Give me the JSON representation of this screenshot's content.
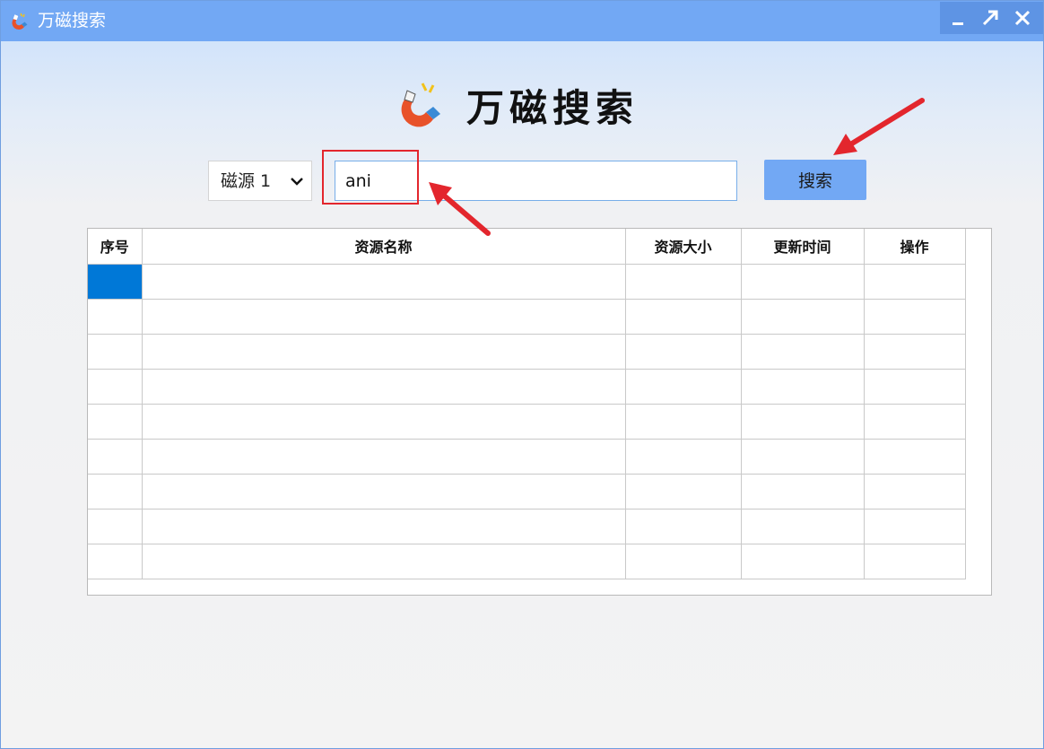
{
  "window": {
    "title": "万磁搜索",
    "icon": "magnet-icon",
    "controls": [
      "minimize-icon",
      "maximize-icon",
      "close-icon"
    ]
  },
  "header": {
    "logo_icon": "magnet-icon",
    "title": "万磁搜索"
  },
  "search": {
    "source_selected": "磁源 1",
    "query_value": "ani",
    "button_label": "搜索"
  },
  "results_table": {
    "columns": [
      "序号",
      "资源名称",
      "资源大小",
      "更新时间",
      "操作"
    ],
    "rows": [
      [
        "",
        "",
        "",
        "",
        ""
      ],
      [
        "",
        "",
        "",
        "",
        ""
      ],
      [
        "",
        "",
        "",
        "",
        ""
      ],
      [
        "",
        "",
        "",
        "",
        ""
      ],
      [
        "",
        "",
        "",
        "",
        ""
      ],
      [
        "",
        "",
        "",
        "",
        ""
      ],
      [
        "",
        "",
        "",
        "",
        ""
      ],
      [
        "",
        "",
        "",
        "",
        ""
      ],
      [
        "",
        "",
        "",
        "",
        ""
      ]
    ],
    "selected_cell": {
      "row": 0,
      "col": 0
    }
  },
  "colors": {
    "titlebar": "#72a8f4",
    "controls_bg": "#5e94e4",
    "accent_button": "#72a8f4",
    "selection": "#0078d7",
    "annotation_red": "#e3262d"
  }
}
